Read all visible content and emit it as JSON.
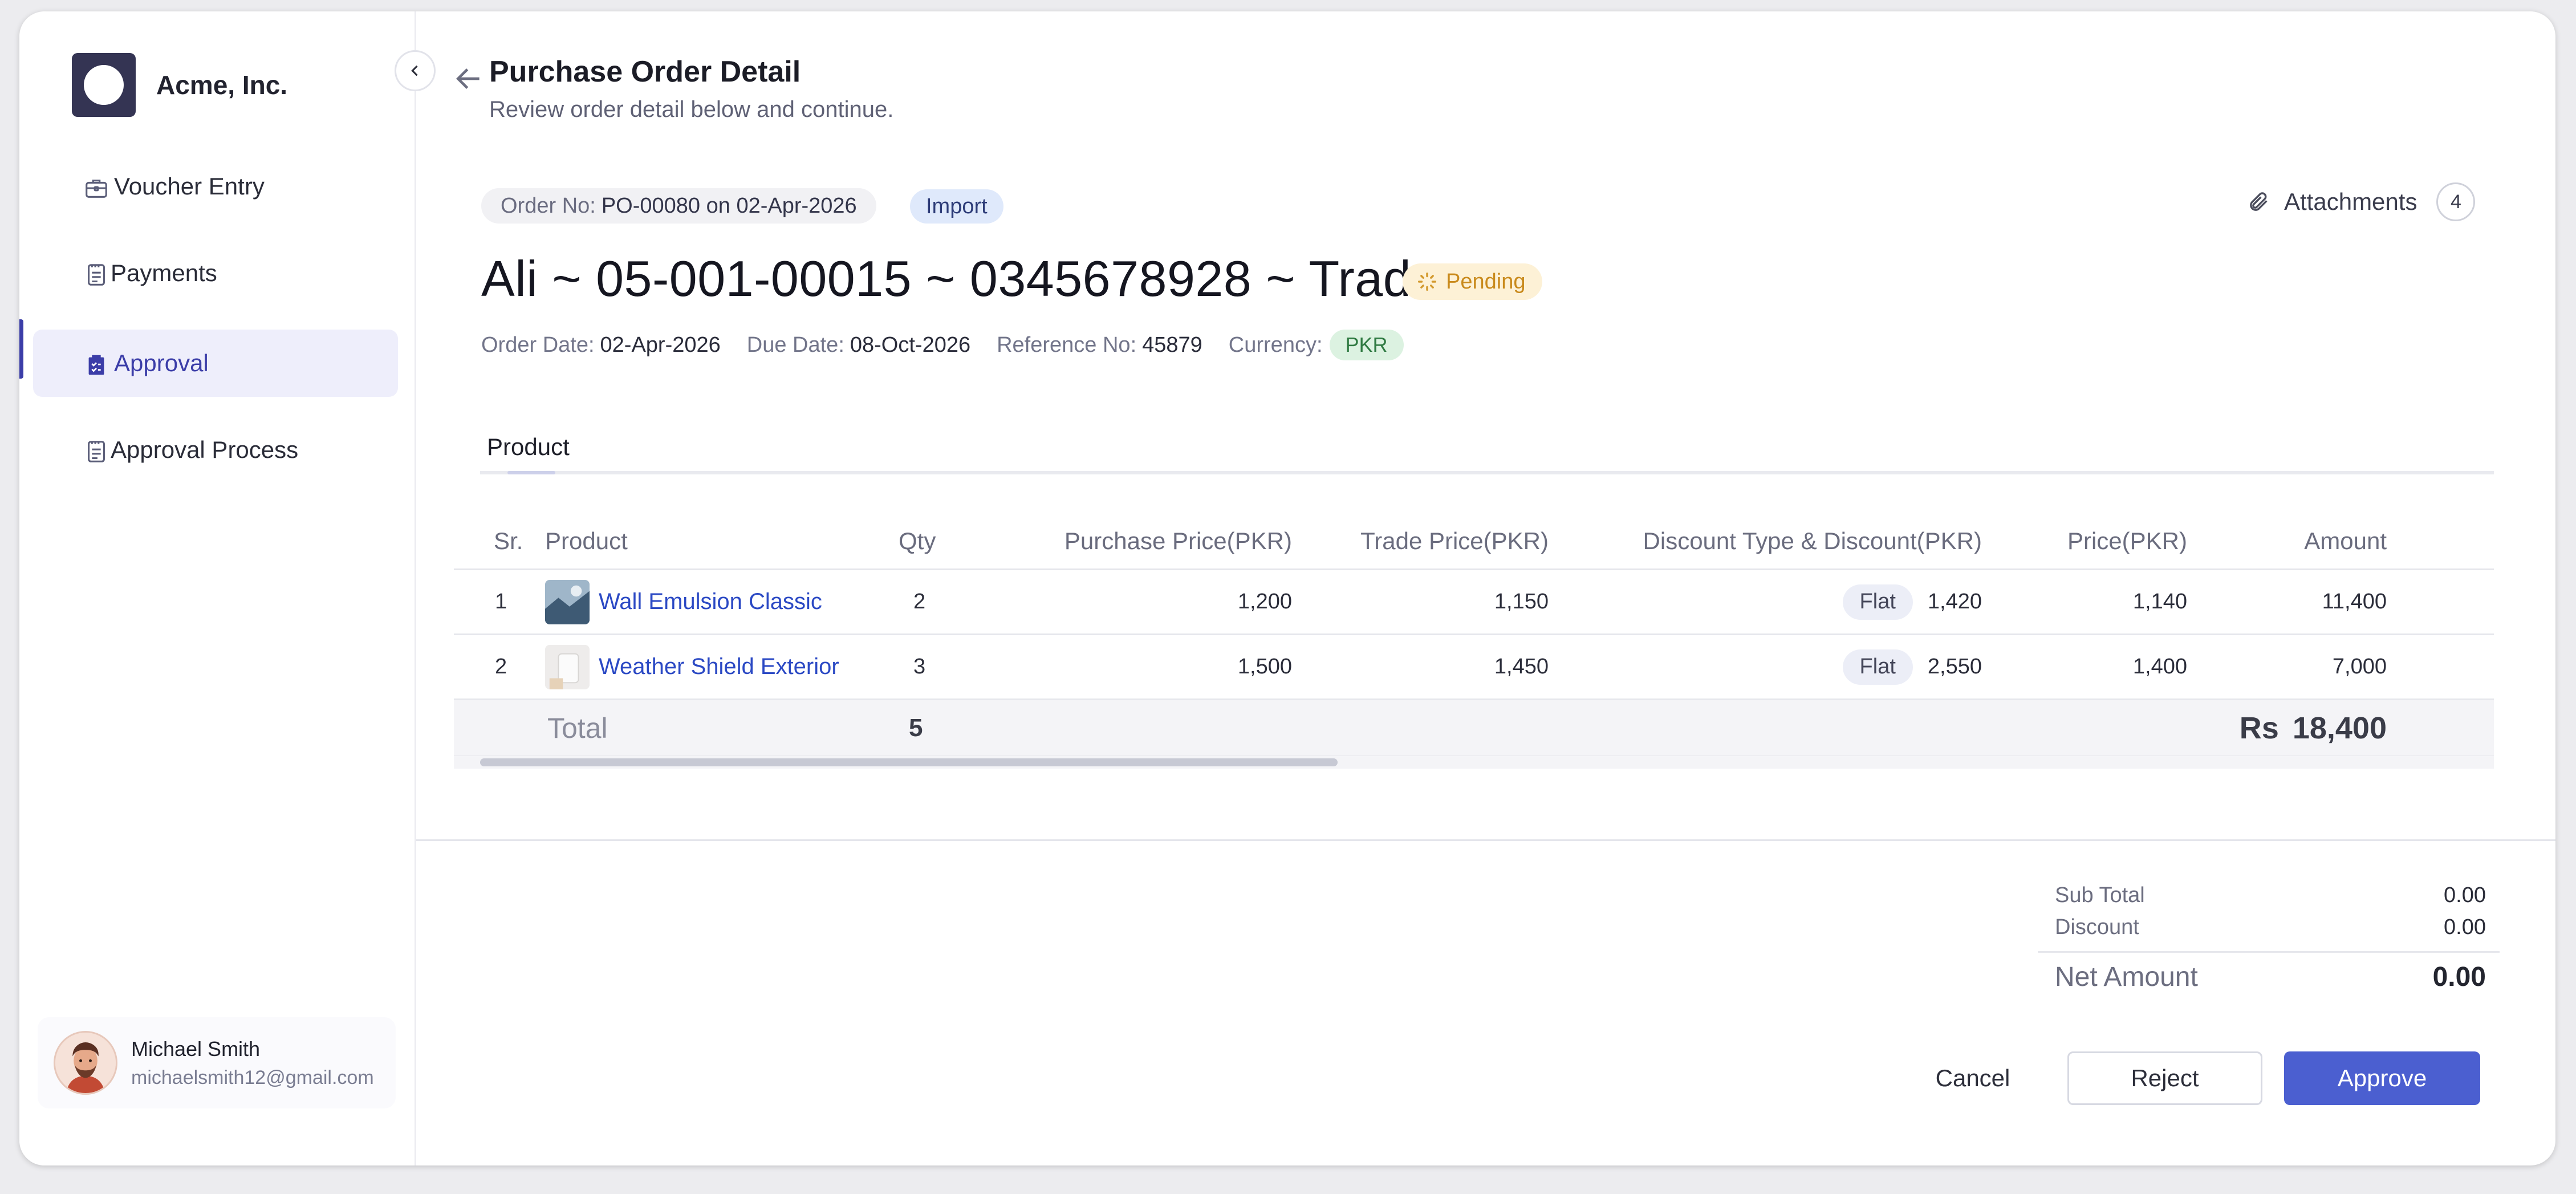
{
  "brand": {
    "name": "Acme, Inc."
  },
  "sidebar": {
    "items": [
      {
        "label": "Voucher Entry",
        "icon": "briefcase-icon",
        "active": false
      },
      {
        "label": "Payments",
        "icon": "document-icon",
        "active": false
      },
      {
        "label": "Approval",
        "icon": "clipboard-check-icon",
        "active": true
      },
      {
        "label": "Approval Process",
        "icon": "document-icon",
        "active": false
      }
    ]
  },
  "user": {
    "name": "Michael Smith",
    "email": "michaelsmith12@gmail.com"
  },
  "header": {
    "title": "Purchase Order Detail",
    "subtitle": "Review order detail below and continue."
  },
  "order": {
    "order_no_label": "Order No:",
    "order_no_value": "PO-00080 on 02-Apr-2026",
    "type_badge": "Import",
    "attachments_label": "Attachments",
    "attachments_count": "4",
    "party": "Ali ~ 05-001-00015 ~ 0345678928 ~ Trade",
    "status": "Pending",
    "order_date_label": "Order Date:",
    "order_date": "02-Apr-2026",
    "due_date_label": "Due Date:",
    "due_date": "08-Oct-2026",
    "reference_label": "Reference No:",
    "reference": "45879",
    "currency_label": "Currency:",
    "currency": "PKR"
  },
  "tabs": {
    "product": "Product"
  },
  "table": {
    "headers": {
      "sr": "Sr.",
      "product": "Product",
      "qty": "Qty",
      "purchase_price": "Purchase Price(PKR)",
      "trade_price": "Trade Price(PKR)",
      "discount": "Discount Type & Discount(PKR)",
      "price": "Price(PKR)",
      "amount": "Amount"
    },
    "rows": [
      {
        "sr": "1",
        "product": "Wall Emulsion Classic",
        "qty": "2",
        "purchase_price": "1,200",
        "trade_price": "1,150",
        "discount_type": "Flat",
        "discount": "1,420",
        "price": "1,140",
        "amount": "11,400"
      },
      {
        "sr": "2",
        "product": "Weather Shield Exterior",
        "qty": "3",
        "purchase_price": "1,500",
        "trade_price": "1,450",
        "discount_type": "Flat",
        "discount": "2,550",
        "price": "1,400",
        "amount": "7,000"
      }
    ],
    "total": {
      "label": "Total",
      "qty": "5",
      "currency": "Rs",
      "amount": "18,400"
    },
    "scroll_position": 0.0
  },
  "summary": {
    "sub_total_label": "Sub Total",
    "sub_total": "0.00",
    "discount_label": "Discount",
    "discount": "0.00",
    "net_label": "Net Amount",
    "net": "0.00"
  },
  "actions": {
    "cancel": "Cancel",
    "reject": "Reject",
    "approve": "Approve"
  },
  "colors": {
    "accent": "#3b3da8",
    "primary_button": "#4b5fd0",
    "pending": "#c98a1c",
    "link": "#2b49c4"
  }
}
